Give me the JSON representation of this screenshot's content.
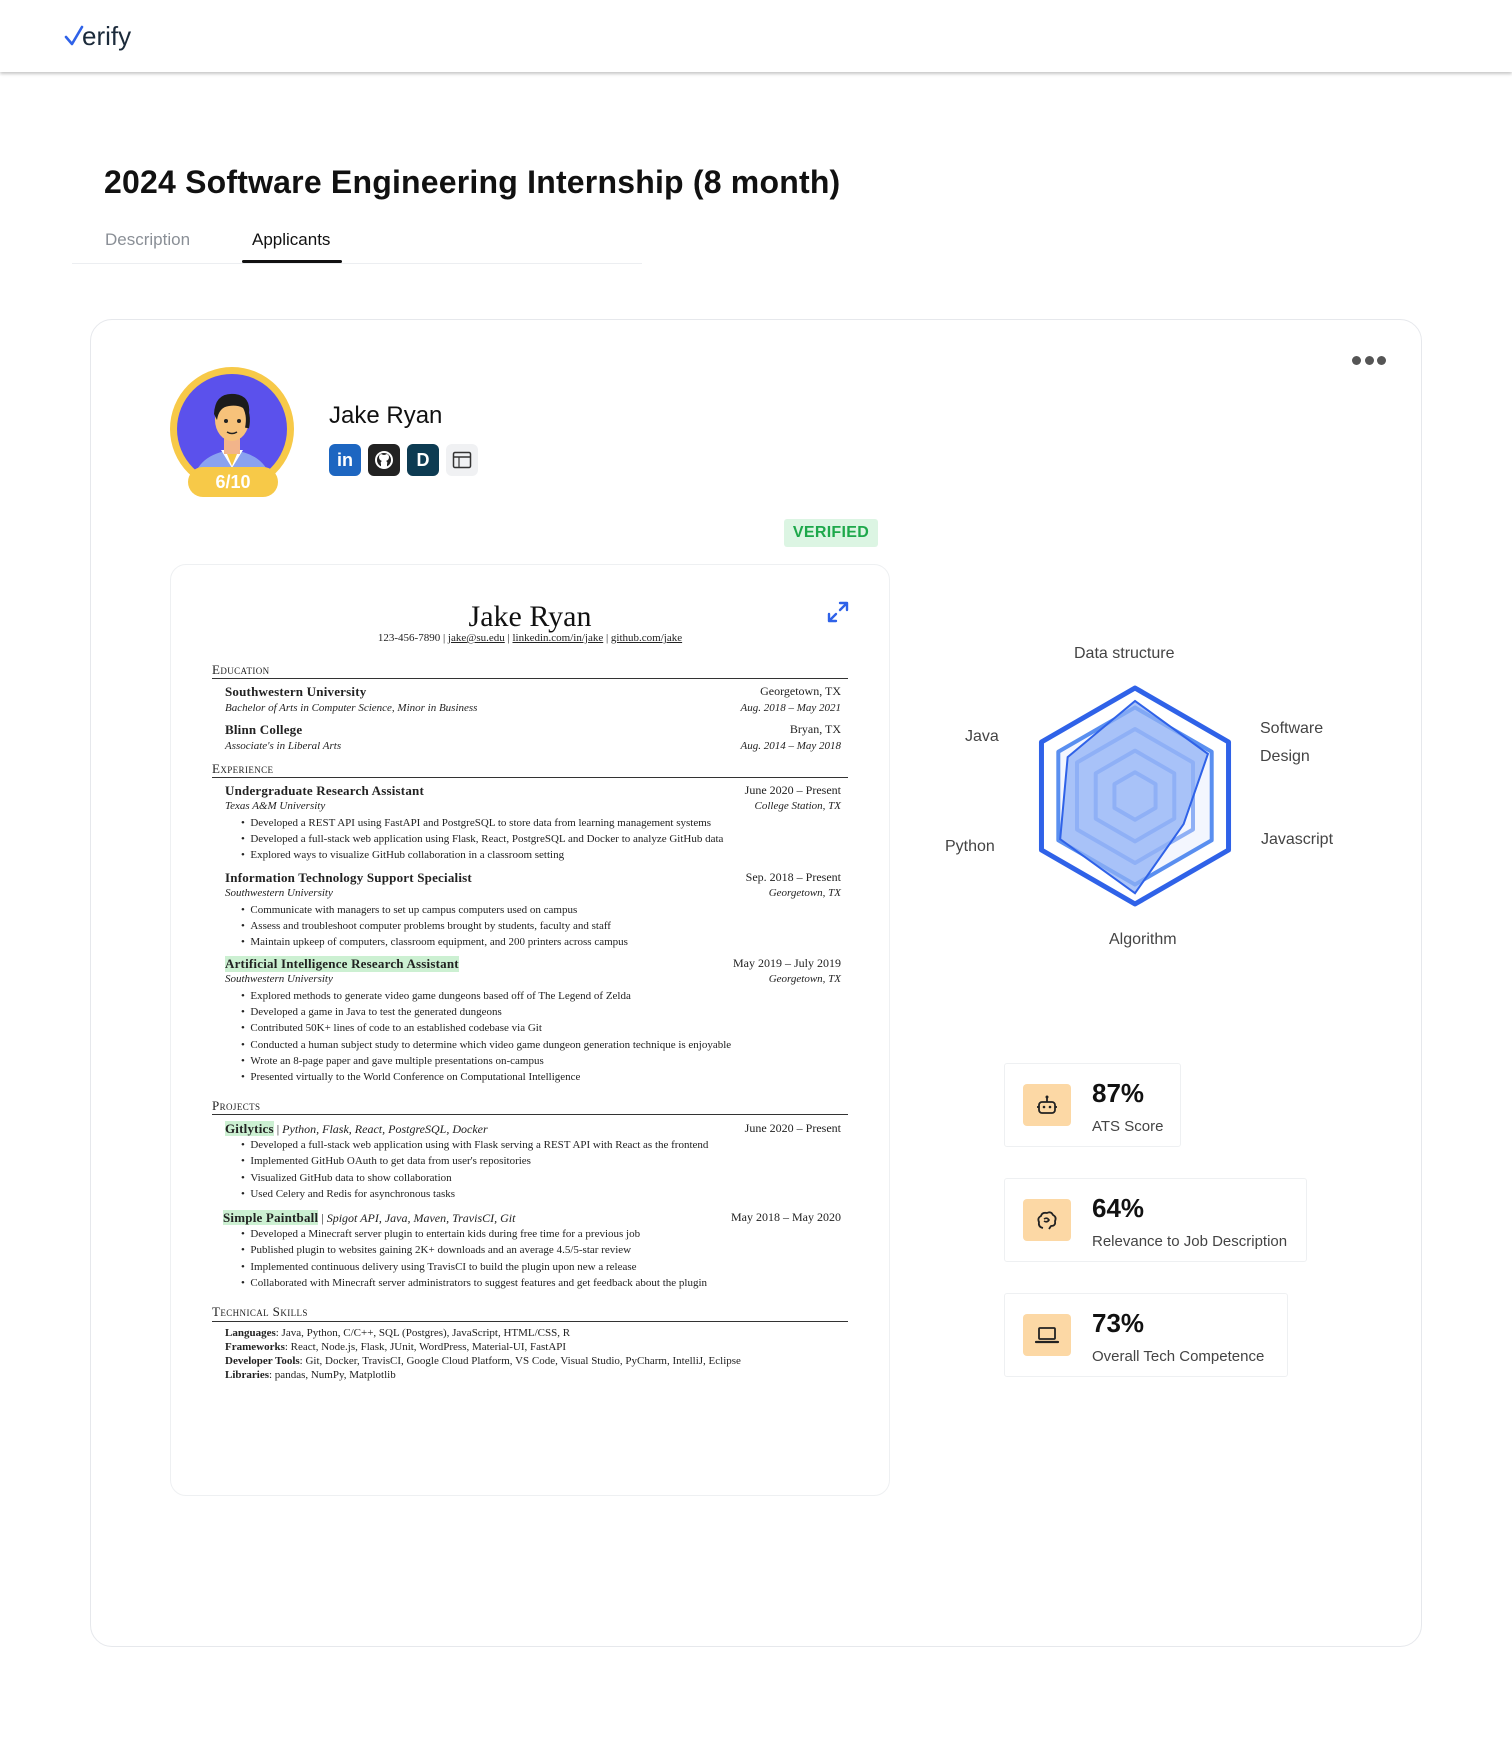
{
  "app": {
    "logo_check": "✓",
    "logo_text": "erify"
  },
  "job": {
    "title": "2024 Software Engineering Internship (8 month)"
  },
  "tabs": [
    {
      "label": "Description"
    },
    {
      "label": "Applicants"
    }
  ],
  "applicant": {
    "name": "Jake Ryan",
    "score": "6/10",
    "status": "VERIFIED",
    "socials": [
      {
        "icon": "linkedin-icon",
        "label": "in"
      },
      {
        "icon": "github-icon"
      },
      {
        "icon": "devpost-icon",
        "label": "D"
      },
      {
        "icon": "website-icon"
      }
    ]
  },
  "resume": {
    "name": "Jake Ryan",
    "contact": [
      "123-456-7890",
      "jake@su.edu",
      "linkedin.com/in/jake",
      "github.com/jake"
    ],
    "sections": {
      "education": "Education",
      "experience": "Experience",
      "projects": "Projects",
      "skills": "Technical Skills"
    },
    "education": [
      {
        "school": "Southwestern University",
        "location": "Georgetown, TX",
        "degree": "Bachelor of Arts in Computer Science, Minor in Business",
        "dates": "Aug. 2018 – May 2021"
      },
      {
        "school": "Blinn College",
        "location": "Bryan, TX",
        "degree": "Associate's in Liberal Arts",
        "dates": "Aug. 2014 – May 2018"
      }
    ],
    "experience": [
      {
        "role": "Undergraduate Research Assistant",
        "dates": "June 2020 – Present",
        "org": "Texas A&M University",
        "location": "College Station, TX",
        "bullets": [
          "Developed a REST API using FastAPI and PostgreSQL to store data from learning management systems",
          "Developed a full-stack web application using Flask, React, PostgreSQL and Docker to analyze GitHub data",
          "Explored ways to visualize GitHub collaboration in a classroom setting"
        ]
      },
      {
        "role": "Information Technology Support Specialist",
        "dates": "Sep. 2018 – Present",
        "org": "Southwestern University",
        "location": "Georgetown, TX",
        "bullets": [
          "Communicate with managers to set up campus computers used on campus",
          "Assess and troubleshoot computer problems brought by students, faculty and staff",
          "Maintain upkeep of computers, classroom equipment, and 200 printers across campus"
        ]
      },
      {
        "role": "Artificial Intelligence Research Assistant",
        "dates": "May 2019 – July 2019",
        "org": "Southwestern University",
        "location": "Georgetown, TX",
        "bullets": [
          "Explored methods to generate video game dungeons based off of The Legend of Zelda",
          "Developed a game in Java to test the generated dungeons",
          "Contributed 50K+ lines of code to an established codebase via Git",
          "Conducted a human subject study to determine which video game dungeon generation technique is enjoyable",
          "Wrote an 8-page paper and gave multiple presentations on-campus",
          "Presented virtually to the World Conference on Computational Intelligence"
        ]
      }
    ],
    "projects": [
      {
        "name": "Gitlytics",
        "stack": "Python, Flask, React, PostgreSQL, Docker",
        "dates": "June 2020 – Present",
        "bullets": [
          "Developed a full-stack web application using with Flask serving a REST API with React as the frontend",
          "Implemented GitHub OAuth to get data from user's repositories",
          "Visualized GitHub data to show collaboration",
          "Used Celery and Redis for asynchronous tasks"
        ]
      },
      {
        "name": "Simple Paintball",
        "stack": "Spigot API, Java, Maven, TravisCI, Git",
        "dates": "May 2018 – May 2020",
        "bullets": [
          "Developed a Minecraft server plugin to entertain kids during free time for a previous job",
          "Published plugin to websites gaining 2K+ downloads and an average 4.5/5-star review",
          "Implemented continuous delivery using TravisCI to build the plugin upon new a release",
          "Collaborated with Minecraft server administrators to suggest features and get feedback about the plugin"
        ]
      }
    ],
    "skills": [
      {
        "label": "Languages",
        "value": ": Java, Python, C/C++, SQL (Postgres), JavaScript, HTML/CSS, R"
      },
      {
        "label": "Frameworks",
        "value": ": React, Node.js, Flask, JUnit, WordPress, Material-UI, FastAPI"
      },
      {
        "label": "Developer Tools",
        "value": ": Git, Docker, TravisCI, Google Cloud Platform, VS Code, Visual Studio, PyCharm, IntelliJ, Eclipse"
      },
      {
        "label": "Libraries",
        "value": ": pandas, NumPy, Matplotlib"
      }
    ]
  },
  "skills_radar": {
    "axes": [
      "Data structure",
      "Software Design",
      "Javascript",
      "Algorithm",
      "Python",
      "Java"
    ],
    "values": [
      0.88,
      0.78,
      0.52,
      0.9,
      0.8,
      0.72
    ],
    "colors": {
      "outer": "#2f62e8",
      "mid": "#5a8ff0",
      "fill": "#8fb0f5"
    }
  },
  "metrics": [
    {
      "icon": "robot-icon",
      "value": "87%",
      "label": "ATS Score"
    },
    {
      "icon": "brain-icon",
      "value": "64%",
      "label": "Relevance to Job Description"
    },
    {
      "icon": "laptop-icon",
      "value": "73%",
      "label": "Overall Tech Competence"
    }
  ]
}
